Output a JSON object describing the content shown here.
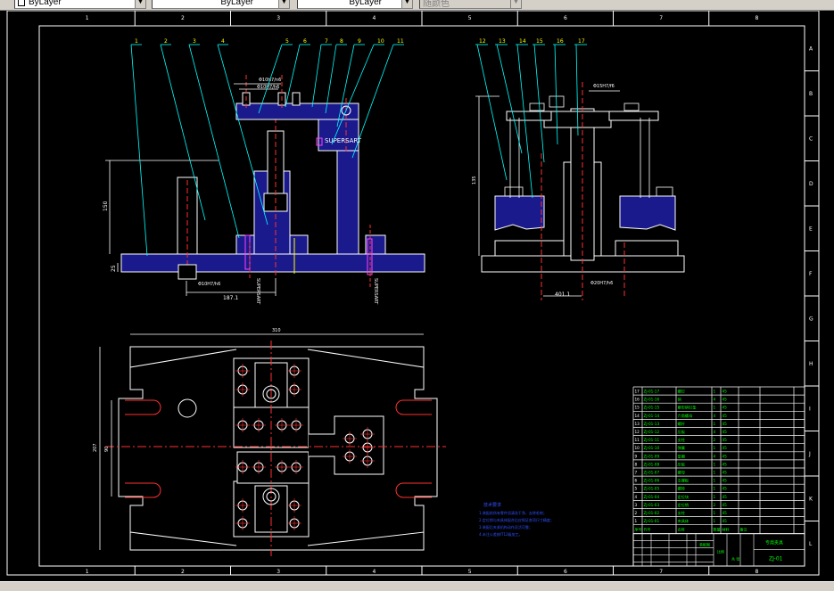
{
  "toolbar": {
    "color_value": "ByLayer",
    "linetype_value": "ByLayer",
    "lineweight_value": "ByLayer",
    "plotstyle_value": "随颜色"
  },
  "frame": {
    "columns": [
      "1",
      "2",
      "3",
      "4",
      "5",
      "6",
      "7",
      "8"
    ],
    "rows": [
      "A",
      "B",
      "C",
      "D",
      "E",
      "F",
      "G",
      "H",
      "I",
      "J",
      "K",
      "L"
    ]
  },
  "front_view": {
    "leaders": [
      "1",
      "2",
      "3",
      "4",
      "5",
      "6",
      "7",
      "8",
      "9",
      "10",
      "11"
    ],
    "dims": {
      "height": "150",
      "base": "25",
      "fit_top": "Φ10H7/n6",
      "fit_top2": "Φ10H7/h6",
      "fit_bottom": "Φ10H7/h6",
      "length": "187.1"
    },
    "text_supersart": "SUPERSART"
  },
  "side_view": {
    "leaders": [
      "12",
      "13",
      "14",
      "15",
      "16",
      "17"
    ],
    "dims": {
      "height": "135",
      "fit_top": "Φ15H7/f6",
      "fit_bottom": "Φ20H7/h6",
      "length": "401.1"
    }
  },
  "top_view": {
    "dims": {
      "width": "310",
      "height": "207",
      "inner": "90"
    }
  },
  "notes": {
    "title": "技术要求",
    "lines": [
      "1.装配前所有零件须清洗干净，去除毛刺；",
      "2.定位销与夹具体配合后应保证各项尺寸精度；",
      "3.装配后夹紧机构动作灵活可靠；",
      "4.未注公差按IT12级加工。"
    ]
  },
  "parts_list": [
    {
      "no": "17",
      "code": "ZJ-01-17",
      "name": "螺钉",
      "qty": "1",
      "mat": "45"
    },
    {
      "no": "16",
      "code": "ZJ-01-16",
      "name": "销",
      "qty": "4",
      "mat": "45"
    },
    {
      "no": "15",
      "code": "ZJ-01-15",
      "name": "菱形销钉垫",
      "qty": "1",
      "mat": "45"
    },
    {
      "no": "14",
      "code": "ZJ-01-14",
      "name": "六角螺母",
      "qty": "4",
      "mat": "45"
    },
    {
      "no": "13",
      "code": "ZJ-01-13",
      "name": "螺杆",
      "qty": "1",
      "mat": "45"
    },
    {
      "no": "12",
      "code": "ZJ-01-12",
      "name": "压板",
      "qty": "4",
      "mat": "45"
    },
    {
      "no": "11",
      "code": "ZJ-01-11",
      "name": "支柱",
      "qty": "2",
      "mat": "45"
    },
    {
      "no": "10",
      "code": "ZJ-01-10",
      "name": "弹簧",
      "qty": "1",
      "mat": "45"
    },
    {
      "no": "9",
      "code": "ZJ-01-09",
      "name": "垫圈",
      "qty": "4",
      "mat": "45"
    },
    {
      "no": "8",
      "code": "ZJ-01-08",
      "name": "压板",
      "qty": "1",
      "mat": "45"
    },
    {
      "no": "7",
      "code": "ZJ-01-07",
      "name": "螺母",
      "qty": "1",
      "mat": "45"
    },
    {
      "no": "6",
      "code": "ZJ-01-06",
      "name": "支撑板",
      "qty": "1",
      "mat": "45"
    },
    {
      "no": "5",
      "code": "ZJ-01-05",
      "name": "螺栓",
      "qty": "1",
      "mat": "45"
    },
    {
      "no": "4",
      "code": "ZJ-01-04",
      "name": "定位块",
      "qty": "1",
      "mat": "45"
    },
    {
      "no": "3",
      "code": "ZJ-01-03",
      "name": "定位销",
      "qty": "2",
      "mat": "45"
    },
    {
      "no": "2",
      "code": "ZJ-01-02",
      "name": "支柱",
      "qty": "1",
      "mat": "45"
    },
    {
      "no": "1",
      "code": "ZJ-01-01",
      "name": "夹具体",
      "qty": "1",
      "mat": "45"
    }
  ],
  "title_block": {
    "header": [
      "序号",
      "代号",
      "名称",
      "数量",
      "材料",
      "备注"
    ],
    "drawing_title": "专用夹具",
    "drawing_no": "ZJ-01",
    "label_left": "装配图",
    "label_scale": "比例",
    "label_sheet": "共 张"
  }
}
